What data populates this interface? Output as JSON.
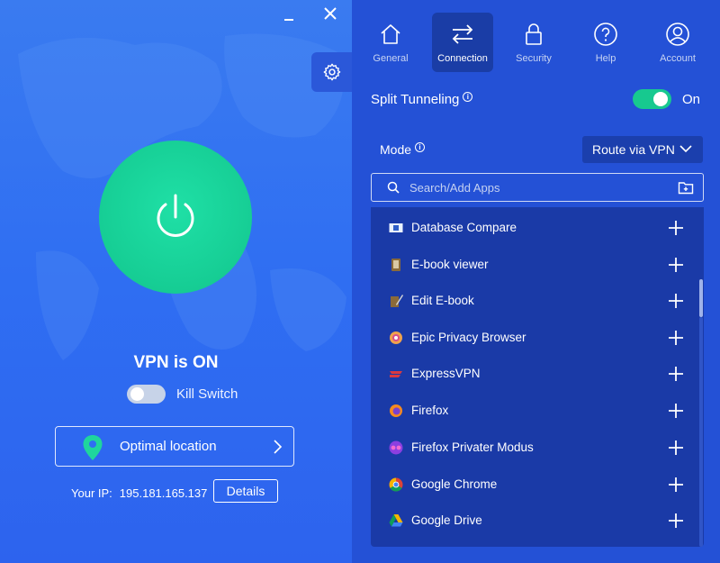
{
  "window": {
    "minimize_icon": "minimize-icon",
    "close_icon": "close-icon"
  },
  "status": {
    "title": "VPN is ON",
    "kill_switch_label": "Kill Switch",
    "kill_switch_on": false
  },
  "location": {
    "label": "Optimal location"
  },
  "ip": {
    "label": "Your IP:",
    "value": "195.181.165.137",
    "details_label": "Details"
  },
  "nav": {
    "tabs": [
      {
        "label": "General",
        "icon": "home-icon",
        "active": false
      },
      {
        "label": "Connection",
        "icon": "swap-arrows-icon",
        "active": true
      },
      {
        "label": "Security",
        "icon": "lock-icon",
        "active": false
      },
      {
        "label": "Help",
        "icon": "help-icon",
        "active": false
      },
      {
        "label": "Account",
        "icon": "account-icon",
        "active": false
      }
    ]
  },
  "split": {
    "label": "Split Tunneling",
    "info": "i",
    "state_label": "On",
    "enabled": true
  },
  "mode": {
    "label": "Mode",
    "info": "i",
    "value": "Route via VPN"
  },
  "search": {
    "placeholder": "Search/Add Apps"
  },
  "apps": [
    {
      "name": "Database Compare"
    },
    {
      "name": "E-book viewer"
    },
    {
      "name": "Edit E-book"
    },
    {
      "name": "Epic Privacy Browser"
    },
    {
      "name": "ExpressVPN"
    },
    {
      "name": "Firefox"
    },
    {
      "name": "Firefox Privater Modus"
    },
    {
      "name": "Google Chrome"
    },
    {
      "name": "Google Drive"
    }
  ],
  "colors": {
    "accent_green": "#16cd94",
    "left_bg": "#2f6ef2",
    "right_bg": "#2451d6",
    "list_bg": "#1a3aa7"
  }
}
